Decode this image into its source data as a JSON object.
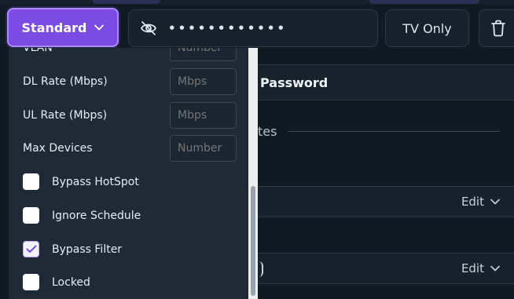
{
  "toolbar": {
    "mode_label": "Standard",
    "password_mask": "••••••••••••",
    "tv_label": "TV Only"
  },
  "background": {
    "password_heading": "Password",
    "partial_heading": "tes",
    "rows": [
      {
        "edit_label": "Edit"
      },
      {
        "edit_label": "Edit"
      }
    ]
  },
  "dropdown": {
    "fields": [
      {
        "label": "VLAN",
        "placeholder": "Number"
      },
      {
        "label": "DL Rate (Mbps)",
        "placeholder": "Mbps"
      },
      {
        "label": "UL Rate (Mbps)",
        "placeholder": "Mbps"
      },
      {
        "label": "Max Devices",
        "placeholder": "Number"
      }
    ],
    "checkboxes": [
      {
        "label": "Bypass HotSpot",
        "checked": false
      },
      {
        "label": "Ignore Schedule",
        "checked": false
      },
      {
        "label": "Bypass Filter",
        "checked": true
      },
      {
        "label": "Locked",
        "checked": false
      }
    ]
  },
  "colors": {
    "accent": "#7b4be3",
    "background": "#0f1a22",
    "panel": "#1e2b36"
  }
}
